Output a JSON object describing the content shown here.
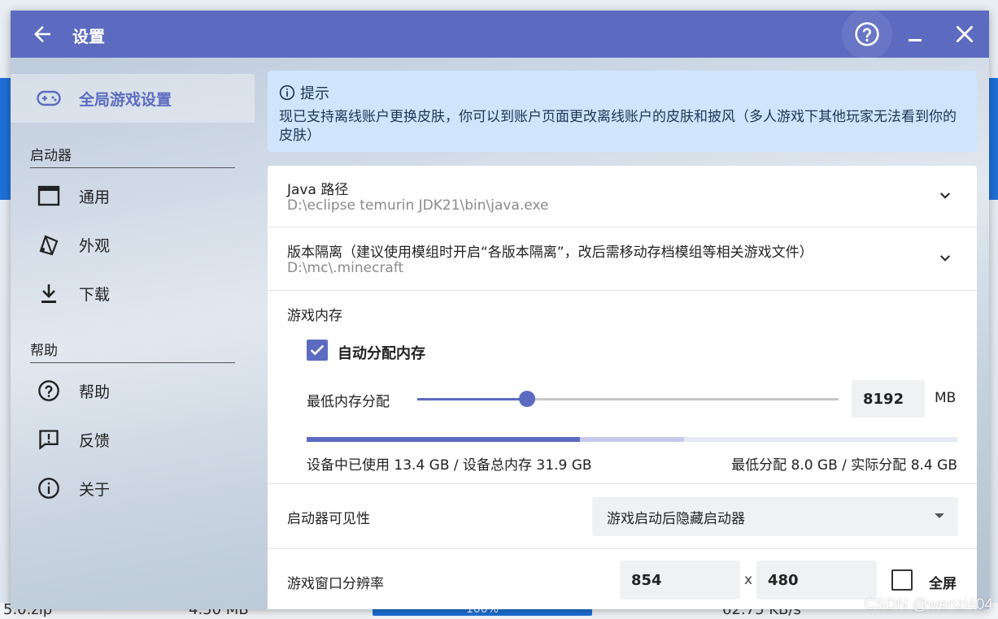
{
  "window": {
    "title": "设置"
  },
  "sidebar": {
    "active_item": "全局游戏设置",
    "section_launcher": "启动器",
    "launcher_items": [
      {
        "label": "通用",
        "icon": "window-icon"
      },
      {
        "label": "外观",
        "icon": "palette-icon"
      },
      {
        "label": "下载",
        "icon": "download-icon"
      }
    ],
    "section_help": "帮助",
    "help_items": [
      {
        "label": "帮助",
        "icon": "help-circle-icon"
      },
      {
        "label": "反馈",
        "icon": "feedback-icon"
      },
      {
        "label": "关于",
        "icon": "info-icon"
      }
    ]
  },
  "tip": {
    "heading": "提示",
    "body": "现已支持离线账户更换皮肤，你可以到账户页面更改离线账户的皮肤和披风（多人游戏下其他玩家无法看到你的皮肤）"
  },
  "settings": {
    "java": {
      "label": "Java 路径",
      "value": "D:\\eclipse temurin JDK21\\bin\\java.exe"
    },
    "isolation": {
      "label": "版本隔离（建议使用模组时开启“各版本隔离”，改后需移动存档模组等相关游戏文件）",
      "value": "D:\\mc\\.minecraft"
    },
    "memory": {
      "label": "游戏内存",
      "auto_label": "自动分配内存",
      "auto_checked": true,
      "min_label": "最低内存分配",
      "min_value": "8192",
      "unit": "MB",
      "slider_fraction": 0.26,
      "used_fraction": 0.42,
      "allocated_fraction": 0.16,
      "usage_text": "设备中已使用 13.4 GB / 设备总内存 31.9 GB",
      "alloc_text": "最低分配 8.0 GB / 实际分配 8.4 GB"
    },
    "visibility": {
      "label": "启动器可见性",
      "selected": "游戏启动后隐藏启动器"
    },
    "resolution": {
      "label": "游戏窗口分辨率",
      "width": "854",
      "separator": "x",
      "height": "480",
      "fullscreen_label": "全屏",
      "fullscreen_checked": false
    }
  },
  "background": {
    "items": [
      "5.0.zip",
      "4.50 MB",
      "100%",
      "62.75 KB/s"
    ]
  },
  "watermark": "CSDN @wenzi404",
  "colors": {
    "accent": "#5c6bc0",
    "tip_bg": "#cfe5fb",
    "bg_blue": "#1e6fd6"
  }
}
